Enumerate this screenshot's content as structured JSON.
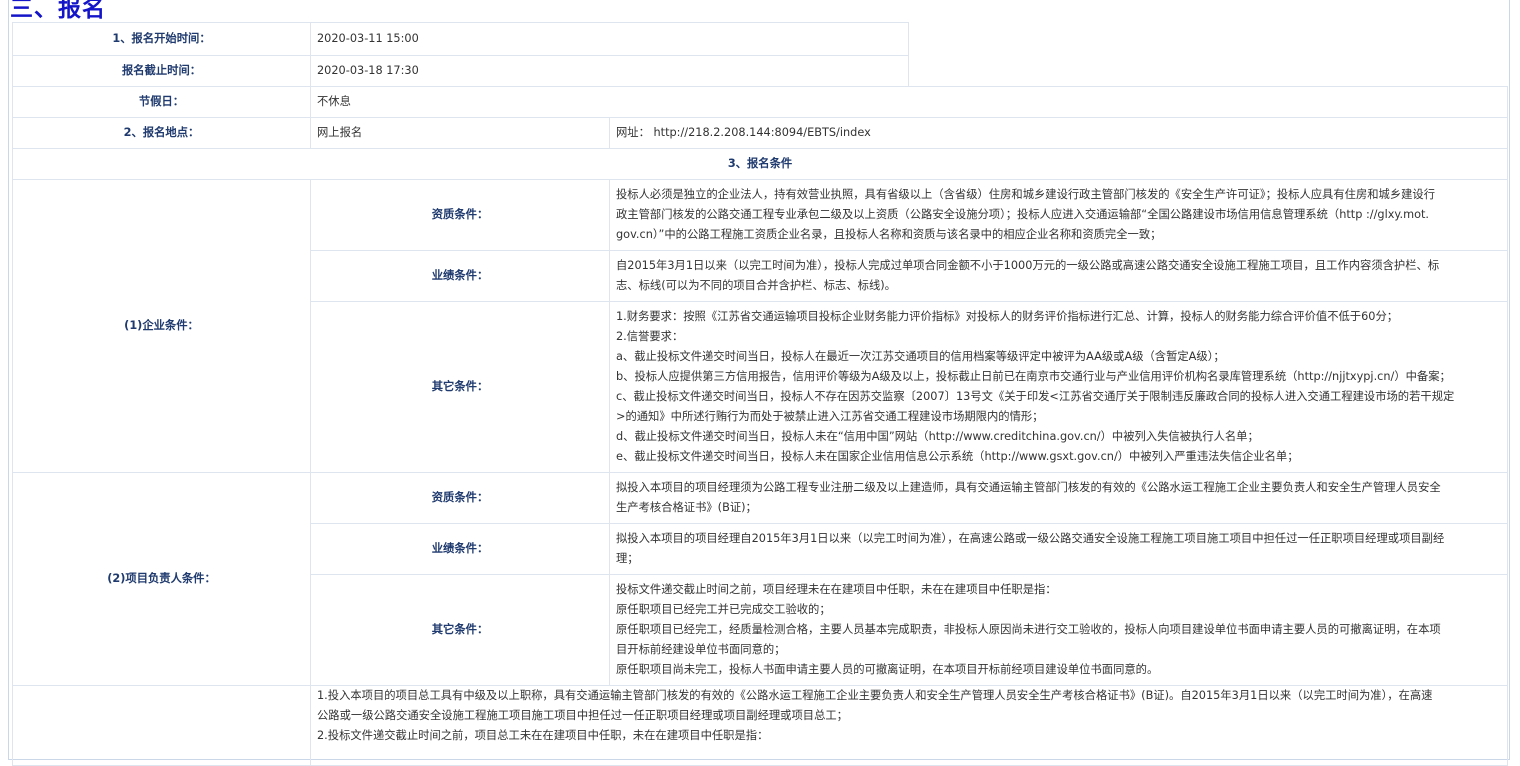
{
  "section_title": "三、报名",
  "basic": {
    "start_label": "1、报名开始时间：",
    "start_value": "2020-03-11 15:00",
    "end_label": "报名截止时间：",
    "end_value": "2020-03-18 17:30",
    "holiday_label": "节假日：",
    "holiday_value": "不休息",
    "place_label": "2、报名地点：",
    "place_value": "网上报名",
    "place_url": "网址： http://218.2.208.144:8094/EBTS/index",
    "conditions_title": "3、报名条件"
  },
  "enterprise": {
    "label": "(1)企业条件：",
    "qualification_label": "资质条件：",
    "qualification_lines": [
      "投标人必须是独立的企业法人，持有效营业执照，具有省级以上（含省级）住房和城乡建设行政主管部门核发的《安全生产许可证》；投标人应具有住房和城乡建设行",
      "政主管部门核发的公路交通工程专业承包二级及以上资质（公路安全设施分项）；投标人应进入交通运输部“全国公路建设市场信用信息管理系统（http ://glxy.mot.",
      "gov.cn）”中的公路工程施工资质企业名录，且投标人名称和资质与该名录中的相应企业名称和资质完全一致；"
    ],
    "performance_label": "业绩条件：",
    "performance_lines": [
      "自2015年3月1日以来（以完工时间为准），投标人完成过单项合同金额不小于1000万元的一级公路或高速公路交通安全设施工程施工项目，且工作内容须含护栏、标",
      "志、标线(可以为不同的项目合并含护栏、标志、标线)。"
    ],
    "other_label": "其它条件：",
    "other_lines": [
      "1.财务要求：按照《江苏省交通运输项目投标企业财务能力评价指标》对投标人的财务评价指标进行汇总、计算，投标人的财务能力综合评价值不低于60分；",
      "2.信誉要求：",
      "a、截止投标文件递交时间当日，投标人在最近一次江苏交通项目的信用档案等级评定中被评为AA级或A级（含暂定A级）；",
      "b、投标人应提供第三方信用报告，信用评价等级为A级及以上，投标截止日前已在南京市交通行业与产业信用评价机构名录库管理系统（http://njjtxypj.cn/）中备案；",
      "c、截止投标文件递交时间当日，投标人不存在因苏交监察〔2007〕13号文《关于印发<江苏省交通厅关于限制违反廉政合同的投标人进入交通工程建设市场的若干规定",
      ">的通知》中所述行贿行为而处于被禁止进入江苏省交通工程建设市场期限内的情形；",
      "d、截止投标文件递交时间当日，投标人未在“信用中国”网站（http://www.creditchina.gov.cn/）中被列入失信被执行人名单；",
      "e、截止投标文件递交时间当日，投标人未在国家企业信用信息公示系统（http://www.gsxt.gov.cn/）中被列入严重违法失信企业名单；"
    ]
  },
  "manager": {
    "label": "(2)项目负责人条件：",
    "qualification_label": "资质条件：",
    "qualification_lines": [
      "拟投入本项目的项目经理须为公路工程专业注册二级及以上建造师，具有交通运输主管部门核发的有效的《公路水运工程施工企业主要负责人和安全生产管理人员安全",
      "生产考核合格证书》(B证)；"
    ],
    "performance_label": "业绩条件：",
    "performance_lines": [
      "拟投入本项目的项目经理自2015年3月1日以来（以完工时间为准），在高速公路或一级公路交通安全设施工程施工项目施工项目中担任过一任正职项目经理或项目副经",
      "理；"
    ],
    "other_label": "其它条件：",
    "other_lines": [
      "投标文件递交截止时间之前，项目经理未在在建项目中任职，未在在建项目中任职是指：",
      "原任职项目已经完工并已完成交工验收的；",
      "原任职项目已经完工，经质量检测合格，主要人员基本完成职责，非投标人原因尚未进行交工验收的，投标人向项目建设单位书面申请主要人员的可撤离证明，在本项",
      "目开标前经建设单位书面同意的；",
      "原任职项目尚未完工，投标人书面申请主要人员的可撤离证明，在本项目开标前经项目建设单位书面同意的。"
    ]
  },
  "chief_engineer": {
    "lines": [
      "1.投入本项目的项目总工具有中级及以上职称，具有交通运输主管部门核发的有效的《公路水运工程施工企业主要负责人和安全生产管理人员安全生产考核合格证书》(B证)。自2015年3月1日以来（以完工时间为准），在高速",
      "公路或一级公路交通安全设施工程施工项目施工项目中担任过一任正职项目经理或项目副经理或项目总工；",
      "2.投标文件递交截止时间之前，项目总工未在在建项目中任职，未在在建项目中任职是指："
    ]
  }
}
